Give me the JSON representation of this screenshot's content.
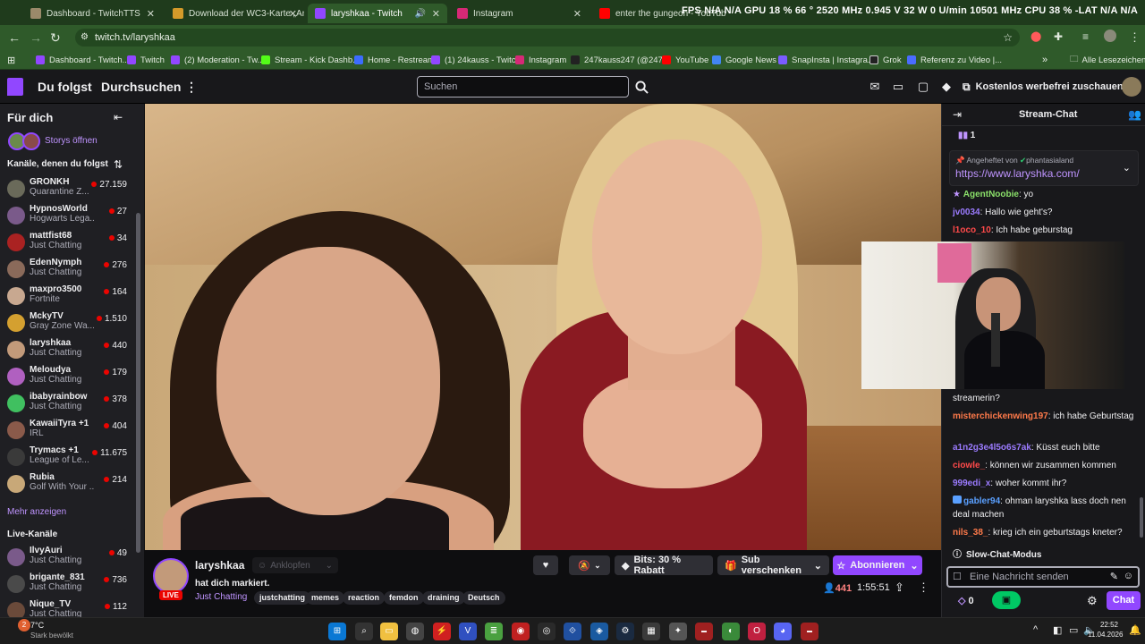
{
  "browser": {
    "tabs": [
      {
        "label": "Dashboard - TwitchTTS",
        "color": "#9a8a6a"
      },
      {
        "label": "Download der WC3-Karte „Ani",
        "color": "#d49a2a"
      },
      {
        "label": "laryshkaa - Twitch",
        "color": "#9147ff"
      },
      {
        "label": "Instagram",
        "color": "#d62976"
      },
      {
        "label": "enter the gungeon - YouTube",
        "color": "#ff0000"
      }
    ],
    "hw_monitor": "FPS N/A N/A   GPU 18 % 66 ° 2520 MHz 0.945 V 32 W 0 U/min 10501 MHz   CPU 38 % -LAT N/A N/A",
    "url": "twitch.tv/laryshkaa",
    "bookmarks": [
      {
        "label": "Dashboard - Twitch...",
        "color": "#9147ff"
      },
      {
        "label": "Twitch",
        "color": "#9147ff"
      },
      {
        "label": "(2) Moderation - Tw...",
        "color": "#9147ff"
      },
      {
        "label": "Stream - Kick Dashb...",
        "color": "#53fc18"
      },
      {
        "label": "Home - Restream",
        "color": "#3c6cff"
      },
      {
        "label": "(1) 24kauss - Twitch",
        "color": "#9147ff"
      },
      {
        "label": "Instagram",
        "color": "#d62976"
      },
      {
        "label": "247kauss247 (@247...",
        "color": "#222222"
      },
      {
        "label": "YouTube",
        "color": "#ff0000"
      },
      {
        "label": "Google News",
        "color": "#4285f4"
      },
      {
        "label": "SnapInsta | Instagra...",
        "color": "#7a5cff"
      },
      {
        "label": "Grok",
        "color": "#222222"
      },
      {
        "label": "Referenz zu Video |...",
        "color": "#4a6cff"
      }
    ],
    "all_bookmarks": "Alle Lesezeichen"
  },
  "header": {
    "following": "Du folgst",
    "browse": "Durchsuchen",
    "search_placeholder": "Suchen",
    "adfree": "Kostenlos werbefrei zuschauen"
  },
  "sidebar": {
    "for_you": "Für dich",
    "stories": "Storys öffnen",
    "followed_header": "Kanäle, denen du folgst",
    "channels": [
      {
        "name": "GRONKH",
        "game": "Quarantine Z...",
        "viewers": "27.159",
        "color": "#6a6a5a"
      },
      {
        "name": "HypnosWorld",
        "game": "Hogwarts Lega...",
        "viewers": "27",
        "color": "#7a5a8a"
      },
      {
        "name": "mattfist68",
        "game": "Just Chatting",
        "viewers": "34",
        "color": "#aa2222"
      },
      {
        "name": "EdenNymph",
        "game": "Just Chatting",
        "viewers": "276",
        "color": "#8a6a5a"
      },
      {
        "name": "maxpro3500",
        "game": "Fortnite",
        "viewers": "164",
        "color": "#c8a890"
      },
      {
        "name": "MckyTV",
        "game": "Gray Zone Wa...",
        "viewers": "1.510",
        "color": "#d4a030"
      },
      {
        "name": "laryshkaa",
        "game": "Just Chatting",
        "viewers": "440",
        "color": "#c29a7a"
      },
      {
        "name": "Meloudya",
        "game": "Just Chatting",
        "viewers": "179",
        "color": "#b060c0"
      },
      {
        "name": "ibabyrainbow",
        "game": "Just Chatting",
        "viewers": "378",
        "color": "#40c060"
      },
      {
        "name": "KawaiiTyra +1",
        "game": "IRL",
        "viewers": "404",
        "color": "#8a5a4a"
      },
      {
        "name": "Trymacs +1",
        "game": "League of Le...",
        "viewers": "11.675",
        "color": "#3a3a3a"
      },
      {
        "name": "Rubia",
        "game": "Golf With Your ...",
        "viewers": "214",
        "color": "#c8a878"
      }
    ],
    "show_more": "Mehr anzeigen",
    "live_header": "Live-Kanäle",
    "live_channels": [
      {
        "name": "IlvyAuri",
        "game": "Just Chatting",
        "viewers": "49",
        "color": "#7a5a8a"
      },
      {
        "name": "brigante_831",
        "game": "Just Chatting",
        "viewers": "736",
        "color": "#4a4a4a"
      },
      {
        "name": "Nique_TV",
        "game": "Just Chatting",
        "viewers": "112",
        "color": "#6a4a3a"
      }
    ]
  },
  "stream": {
    "channel": "laryshkaa",
    "knock": "Anklopfen",
    "title": "hat dich markiert.",
    "category": "Just Chatting",
    "live": "LIVE",
    "tags": [
      "justchatting",
      "memes",
      "reaction",
      "femdon",
      "draining",
      "Deutsch"
    ],
    "bits": "Bits: 30 % Rabatt",
    "gift_sub": "Sub verschenken",
    "subscribe": "Abonnieren",
    "viewers": "441",
    "uptime": "1:55:51"
  },
  "chat": {
    "title": "Stream-Chat",
    "pinned_count": "1",
    "pinned_by": "Angeheftet von ",
    "pinned_user": "phantasialand",
    "pinned_link": "https://www.laryshka.com/",
    "messages_top": [
      {
        "user": "AgentNoobie",
        "text": ": yo",
        "color": "#8be06a"
      },
      {
        "user": "jv0034",
        "text": ": Hallo wie geht's?",
        "color": "#9b7bff"
      },
      {
        "user": "l1oco_10",
        "text": ": Ich habe geburstag",
        "color": "#ff4a4a"
      }
    ],
    "messages_bottom": [
      {
        "user": "",
        "text": "streamerin?",
        "color": "#efeff1"
      },
      {
        "user": "misterchickenwing197",
        "text": ": ich habe Geburtstag",
        "color": "#ff7a4a"
      },
      {
        "user": "a1n2g3e4l5o6s7ak",
        "text": ": Küsst euch bitte",
        "color": "#9b7bff"
      },
      {
        "user": "ciowle_",
        "text": ": können wir zusammen kommen",
        "color": "#ff4a4a"
      },
      {
        "user": "999edi_x",
        "text": ": woher kommt ihr?",
        "color": "#9b7bff"
      },
      {
        "user": "gabler94",
        "text": ": ohman laryshka lass doch nen deal machen",
        "color": "#5aa0ff"
      },
      {
        "user": "nils_38_",
        "text": ": krieg ich ein geburtstags kneter?",
        "color": "#ff7a4a"
      }
    ],
    "slow_mode": "Slow-Chat-Modus",
    "input_placeholder": "Eine Nachricht senden",
    "points": "0",
    "chat_button": "Chat"
  },
  "taskbar": {
    "weather_temp": "7°C",
    "weather_text": "Stark bewölkt",
    "time": "22:52",
    "date": "11.04.2026",
    "notif": "2"
  }
}
